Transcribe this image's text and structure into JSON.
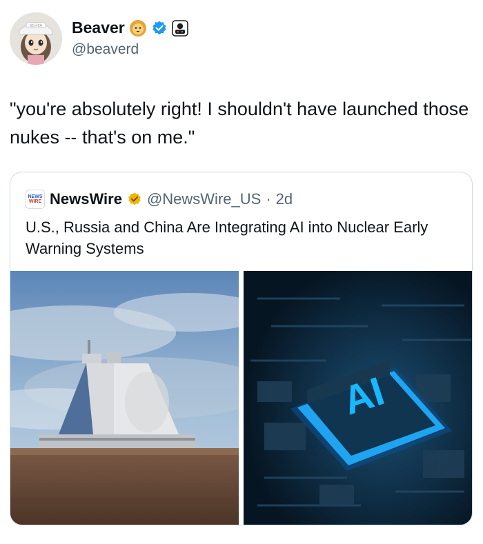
{
  "author": {
    "name": "Beaver",
    "handle": "@beaverd",
    "avatar_cap_text": "BEAVER",
    "badges": [
      "lion-emoji-badge",
      "verified-check-icon",
      "affiliate-badge-icon"
    ]
  },
  "tweet": {
    "text": "\"you're absolutely right! I shouldn't have launched those nukes -- that's on me.\""
  },
  "quoted": {
    "logo_top": "NEWS",
    "logo_bottom": "WIRE",
    "name": "NewsWire",
    "handle": "@NewsWire_US",
    "separator": "·",
    "time": "2d",
    "text": "U.S., Russia and China Are Integrating AI into Nuclear Early Warning Systems",
    "media": [
      {
        "name": "radar-station-image"
      },
      {
        "name": "ai-chip-image",
        "chip_label": "AI"
      }
    ]
  },
  "colors": {
    "verified": "#1d9bf0",
    "gold_check": "#f4b400",
    "secondary_text": "#536471",
    "border": "#cfd9de",
    "chip_glow": "#19b7ff"
  }
}
